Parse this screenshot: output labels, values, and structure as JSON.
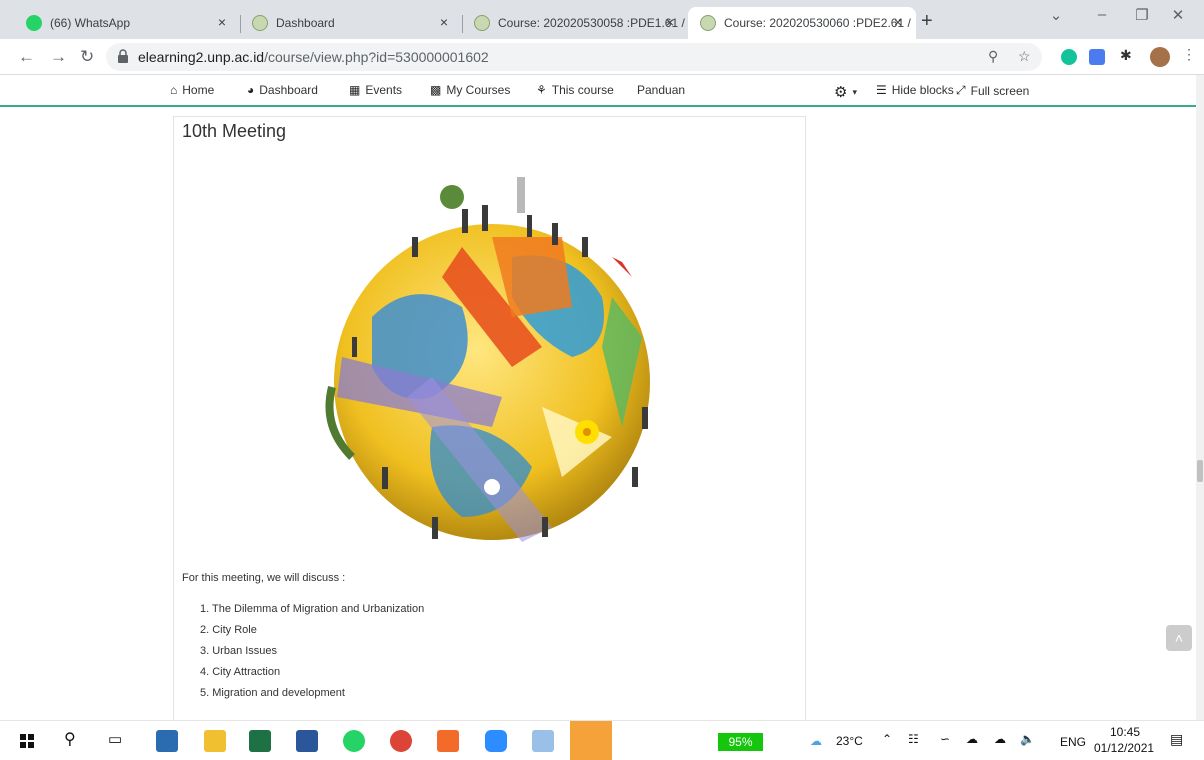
{
  "browser": {
    "tabs": [
      {
        "title": "(66) WhatsApp",
        "favicon_color": "#25d366",
        "badge": "66",
        "active": false
      },
      {
        "title": "Dashboard",
        "favicon_color": "#c8d8b0",
        "active": false
      },
      {
        "title": "Course: 202020530058 :PDE1.61 /",
        "favicon_color": "#c8d8b0",
        "active": false
      },
      {
        "title": "Course: 202020530060 :PDE2.61 /",
        "favicon_color": "#c8d8b0",
        "active": true
      }
    ],
    "close_glyph": "×",
    "new_tab_glyph": "+",
    "url_host": "elearning2.unp.ac.id",
    "url_path": "/course/view.php?id=530000001602"
  },
  "moodle_nav": {
    "home": "Home",
    "dashboard": "Dashboard",
    "events": "Events",
    "my_courses": "My Courses",
    "this_course": "This course",
    "panduan": "Panduan",
    "hide_blocks": "Hide blocks",
    "full_screen": "Full screen"
  },
  "section": {
    "title": "10th Meeting",
    "intro": "For this meeting, we will discuss :",
    "topics": [
      "1. The Dilemma of Migration and Urbanization",
      "2. City Role",
      "3. Urban Issues",
      "4. City Attraction",
      "5. Migration and development"
    ]
  },
  "taskbar": {
    "battery": "95%",
    "weather": "23°C",
    "language": "ENG",
    "time": "10:45",
    "date": "01/12/2021"
  },
  "colors": {
    "accent": "#3aaa8e",
    "tabbar": "#dee1e6",
    "battery": "#16c60c"
  }
}
